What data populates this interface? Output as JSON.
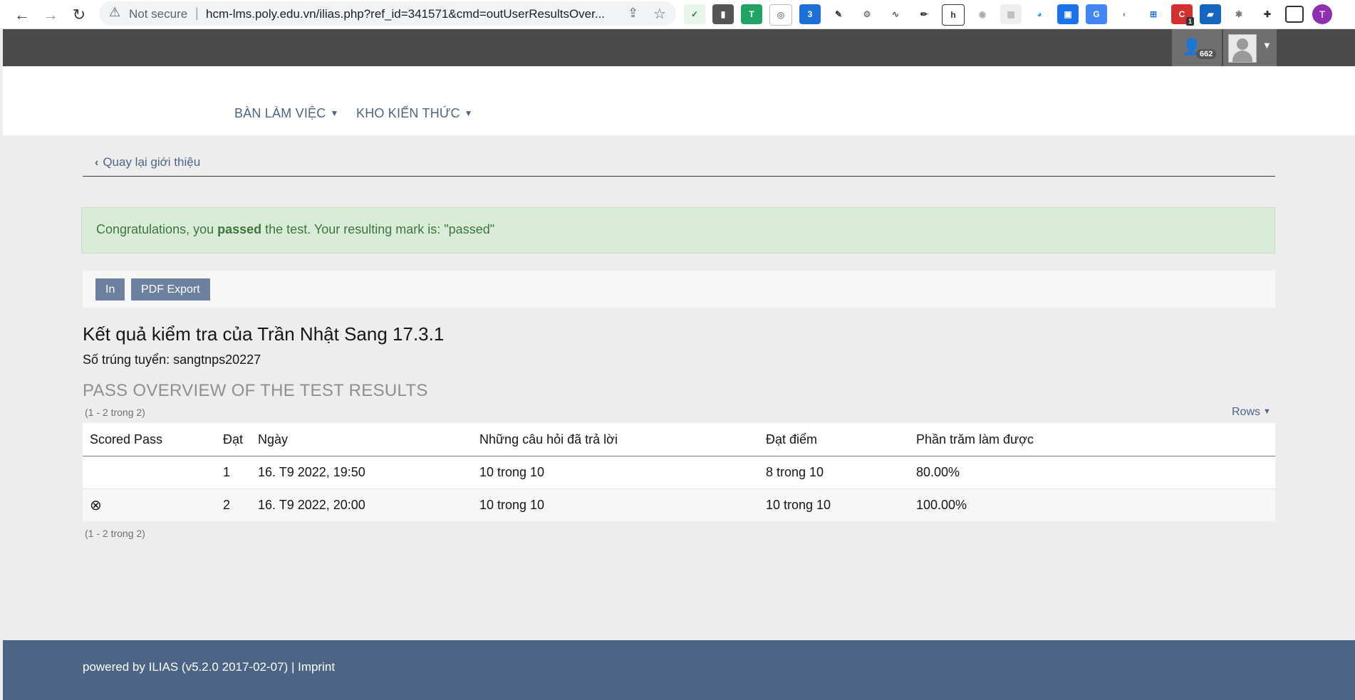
{
  "browser": {
    "security_label": "Not secure",
    "url": "hcm-lms.poly.edu.vn/ilias.php?ref_id=341571&cmd=outUserResultsOver...",
    "profile_initial": "T",
    "extension_badge": "1"
  },
  "header": {
    "notification_count": "662"
  },
  "mainnav": {
    "items": [
      {
        "label": "BÀN LÀM VIỆC"
      },
      {
        "label": "KHO KIẾN THỨC"
      }
    ]
  },
  "back_link": "Quay lại giới thiệu",
  "alert": {
    "prefix": "Congratulations, you ",
    "emphasis": "passed",
    "suffix": " the test. Your resulting mark is: \"passed\"",
    "color": "#3c763d"
  },
  "toolbar": {
    "print_label": "In",
    "pdf_label": "PDF Export"
  },
  "result_title": "Kết quả kiểm tra của Trần Nhật Sang 17.3.1",
  "matriculation": "Số trúng tuyển: sangtnps20227",
  "section_title": "PASS OVERVIEW OF THE TEST RESULTS",
  "range_label": "(1 - 2 trong 2)",
  "rows_label": "Rows",
  "table": {
    "headers": [
      "Scored Pass",
      "Đạt",
      "Ngày",
      "Những câu hỏi đã trả lời",
      "Đạt điểm",
      "Phần trăm làm được"
    ],
    "rows": [
      {
        "scored": "",
        "pass": "1",
        "date": "16. T9 2022, 19:50",
        "answered": "10 trong 10",
        "points": "8 trong 10",
        "percent": "80.00%"
      },
      {
        "scored": "⊗",
        "pass": "2",
        "date": "16. T9 2022, 20:00",
        "answered": "10 trong 10",
        "points": "10 trong 10",
        "percent": "100.00%"
      }
    ]
  },
  "footer": {
    "text": "powered by ILIAS (v5.2.0 2017-02-07) | Imprint",
    "color": "#4c6586"
  }
}
